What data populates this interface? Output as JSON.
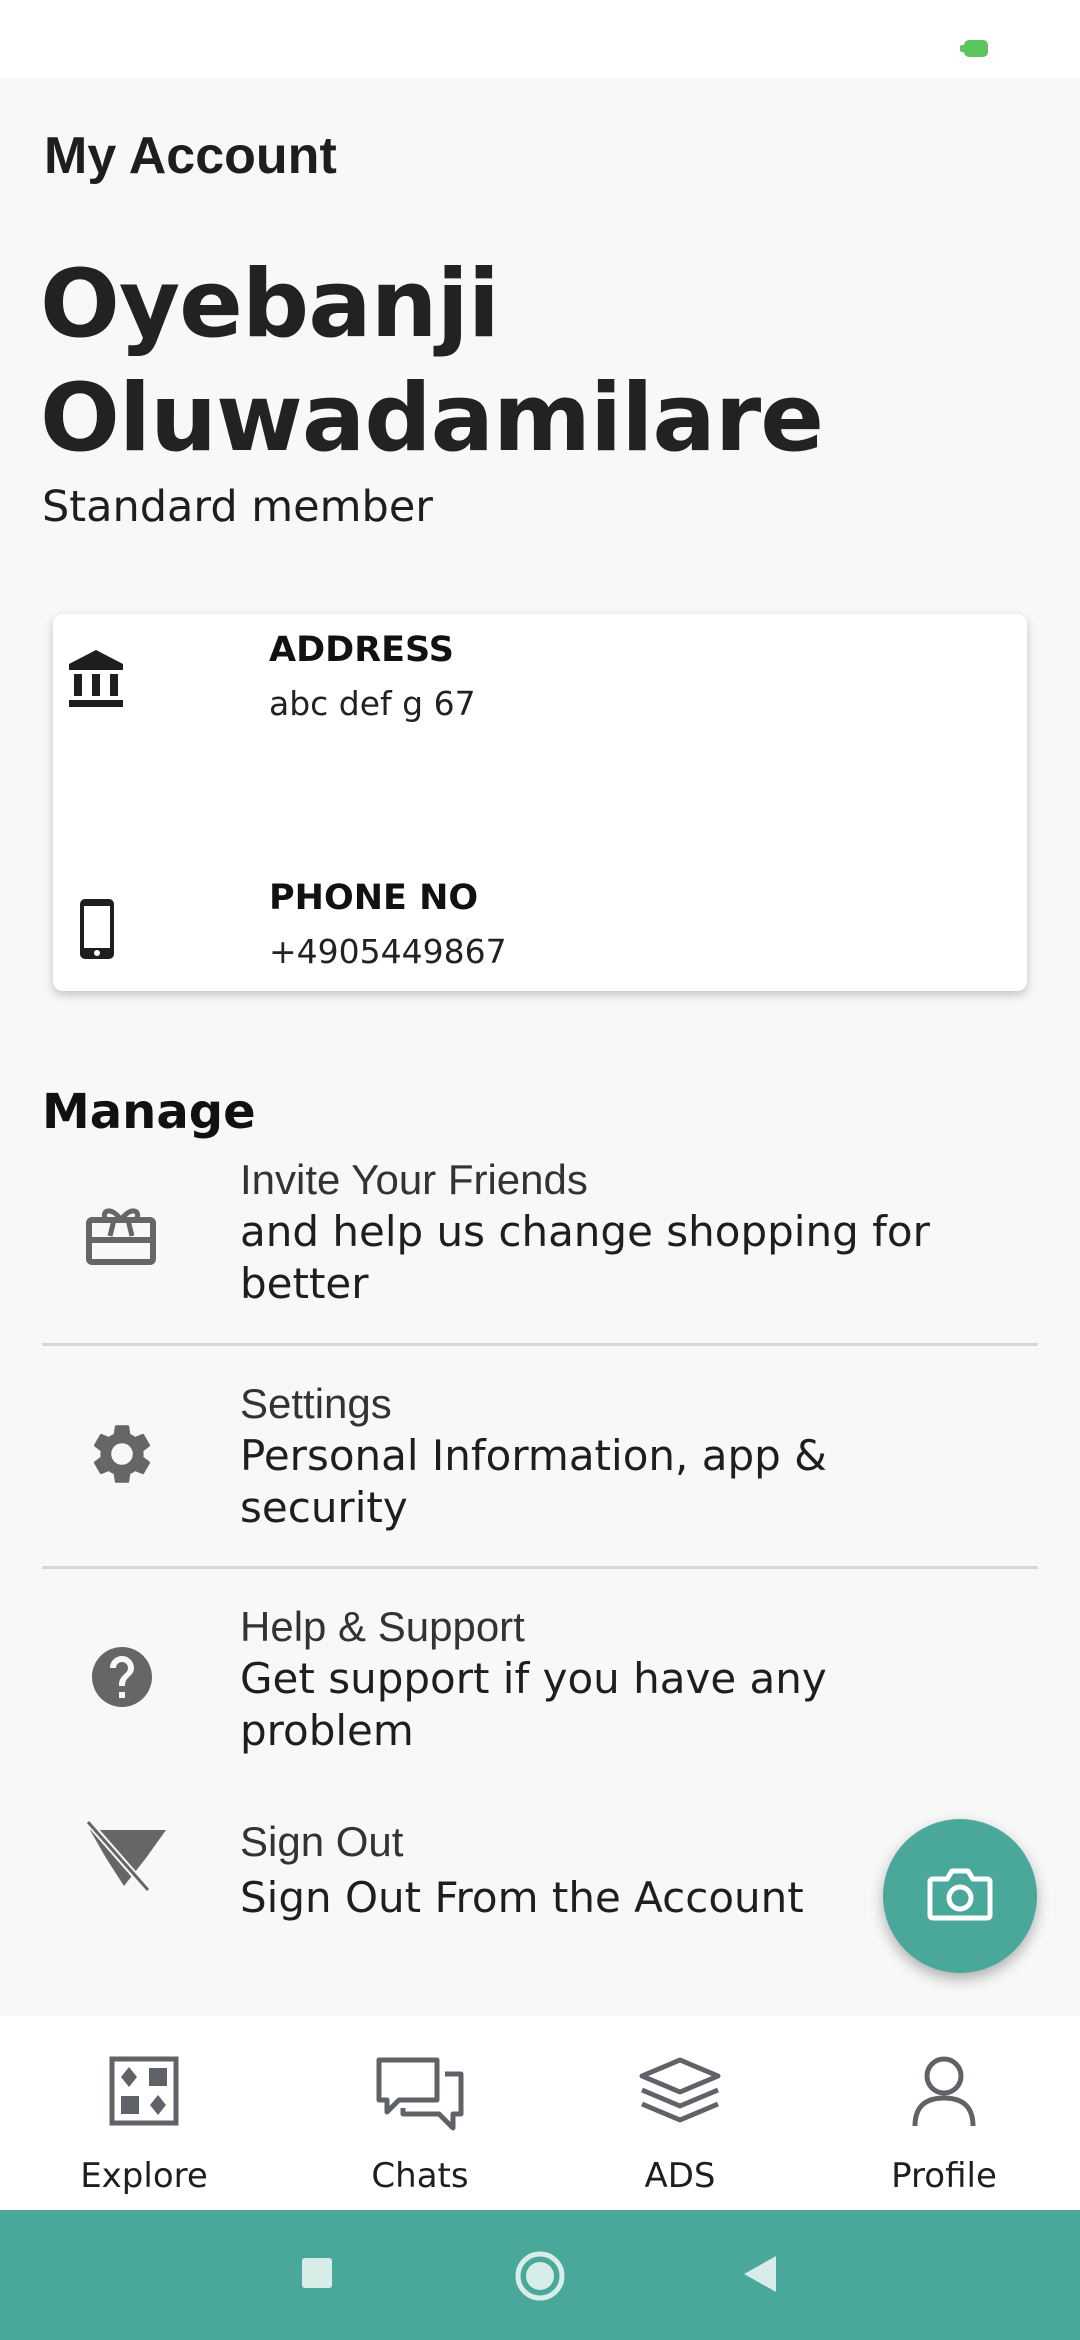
{
  "status_bar": {
    "battery_color": "#5cc45c"
  },
  "header": {
    "title": "My Account"
  },
  "profile": {
    "name": "Oyebanji Oluwadamilare",
    "membership": "Standard member"
  },
  "info_card": {
    "address": {
      "icon": "bank-icon",
      "label": "ADDRESS",
      "value": "abc def g 67"
    },
    "phone": {
      "icon": "smartphone-icon",
      "label": "PHONE NO",
      "value": "+4905449867"
    }
  },
  "manage": {
    "title": "Manage",
    "items": [
      {
        "icon": "gift-icon",
        "title": "Invite Your Friends",
        "description": "and help us change shopping for better"
      },
      {
        "icon": "gear-icon",
        "title": "Settings",
        "description": "Personal Information, app & security"
      },
      {
        "icon": "help-circle-icon",
        "title": "Help & Support",
        "description": "Get support if you have any problem"
      },
      {
        "icon": "sign-out-icon",
        "title": "Sign Out",
        "description": "Sign Out From the Account"
      }
    ]
  },
  "fab": {
    "icon": "camera-icon",
    "color": "#4aa89a"
  },
  "bottom_nav": {
    "items": [
      {
        "icon": "grid-icon",
        "label": "Explore"
      },
      {
        "icon": "chat-icon",
        "label": "Chats"
      },
      {
        "icon": "layers-icon",
        "label": "ADS"
      },
      {
        "icon": "user-icon",
        "label": "Profile"
      }
    ]
  },
  "system_nav": {
    "color": "#4aa89a",
    "buttons": [
      "recents-button",
      "home-button",
      "back-button"
    ]
  }
}
